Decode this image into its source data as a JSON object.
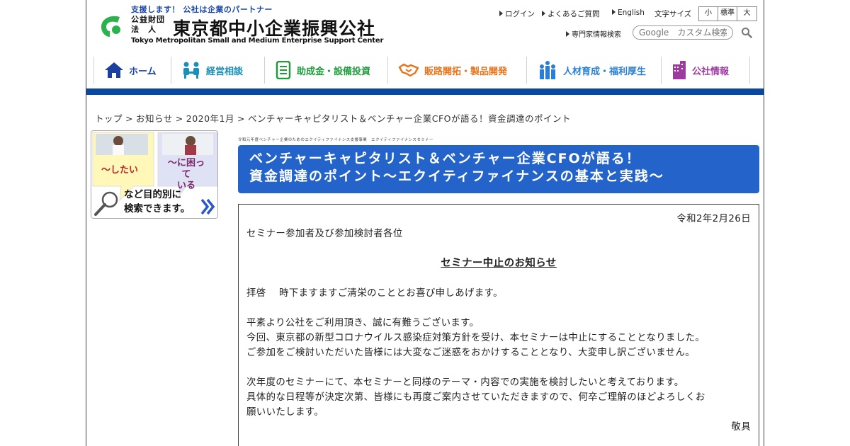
{
  "header": {
    "tagline": "支援します！ 公社は企業のパートナー",
    "corp_type": "公益財団法　人",
    "corp_name": "東京都中小企業振興公社",
    "corp_name_en": "Tokyo Metropolitan Small and Medium Enterprise Support Center",
    "util_links": [
      "ログイン",
      "よくあるご質問",
      "English"
    ],
    "font_size_label": "文字サイズ",
    "font_size_options": [
      "小",
      "標準",
      "大"
    ],
    "expert_link": "専門家情報検索",
    "search_placeholder": "Google　カスタム検索",
    "logo_color": "#2bb24c"
  },
  "nav": {
    "items": [
      {
        "label": "ホーム",
        "color": "#1a3f9c",
        "icon": "house-icon"
      },
      {
        "label": "経営相談",
        "color": "#1a8fb8",
        "icon": "consulting-icon"
      },
      {
        "label": "助成金・設備投資",
        "color": "#1f9b3c",
        "icon": "document-list-icon"
      },
      {
        "label": "販路開拓・製品開発",
        "color": "#e8731a",
        "icon": "handshake-icon"
      },
      {
        "label": "人材育成・福利厚生",
        "color": "#2a7fd4",
        "icon": "people-icon"
      },
      {
        "label": "公社情報",
        "color": "#9c3aa0",
        "icon": "building-icon"
      }
    ],
    "bar_color": "#0a47a1"
  },
  "breadcrumb": {
    "items": [
      "トップ",
      "お知らせ",
      "2020年1月",
      "ベンチャーキャピタリスト＆ベンチャー企業CFOが語る！資金調達のポイント"
    ],
    "separator": ">"
  },
  "banner": {
    "label_left": "～したい",
    "label_right_1": "～に困って",
    "label_right_2": "いる",
    "bottom_1": "など目的別に",
    "bottom_2": "検索できます。"
  },
  "content": {
    "sub_tag": "令和元年度ベンチャー企業のためのエクイティファイナンス支援事業　エクイティファイナンスセミナー",
    "title_line1": "ベンチャーキャピタリスト＆ベンチャー企業CFOが語る！",
    "title_line2": "資金調達のポイント～エクイティファイナンスの基本と実践～",
    "title_bg": "#2463c9",
    "notice": {
      "date": "令和2年2月26日",
      "addressee": "セミナー参加者及び参加検討者各位",
      "heading": "セミナー中止のお知らせ",
      "greeting": "拝啓　 時下ますますご清栄のこととお喜び申しあげます。",
      "p1_l1": "平素より公社をご利用頂き、誠に有難うございます。",
      "p1_l2": "今回、東京都の新型コロナウイルス感染症対策方針を受け、本セミナーは中止にすることとなりました。",
      "p1_l3": "ご参加をご検討いただいた皆様には大変なご迷惑をおかけすることとなり、大変申し訳ございません。",
      "p2_l1": "次年度のセミナーにて、本セミナーと同様のテーマ・内容での実施を検討したいと考えております。",
      "p2_l2": "具体的な日程等が決定次第、皆様にも再度ご案内させていただきますので、何卒ご理解のほどよろしくお",
      "p2_l3": "願いいたします。",
      "closing": "敬具"
    }
  }
}
